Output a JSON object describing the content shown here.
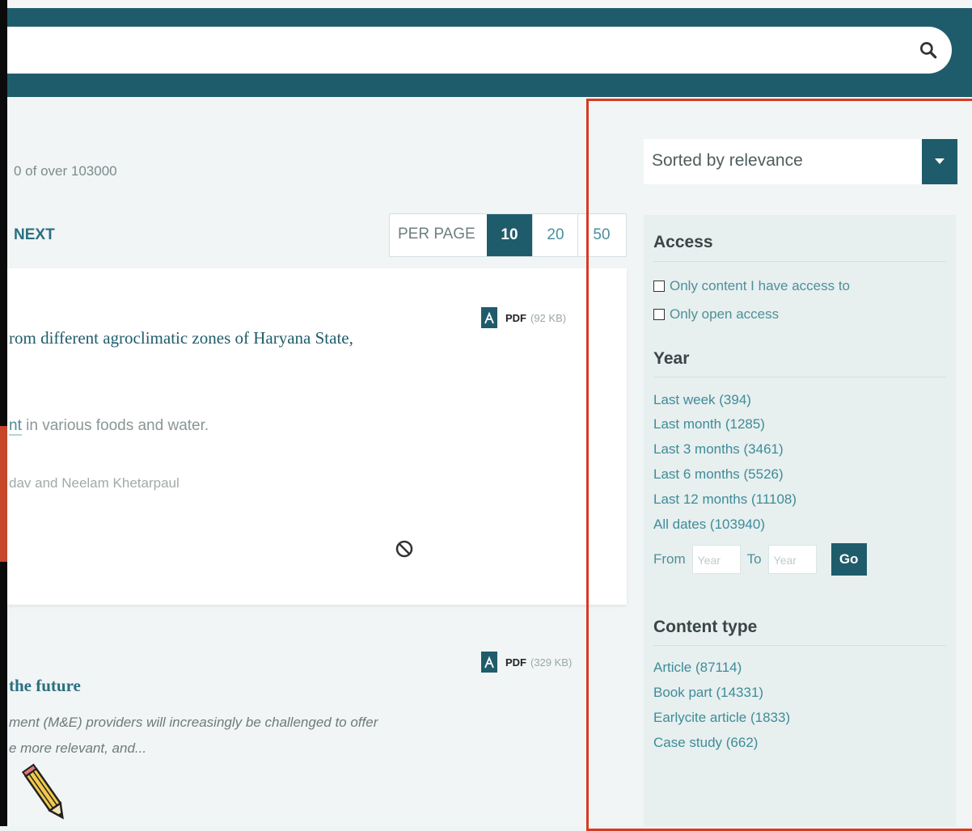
{
  "search": {
    "placeholder": ""
  },
  "results": {
    "count_text": "0 of over 103000",
    "next_label": "NEXT",
    "per_page": {
      "label": "PER PAGE",
      "options": [
        "10",
        "20",
        "50"
      ],
      "selected": "10"
    }
  },
  "cards": [
    {
      "title": "rom different agroclimatic zones of Haryana State,",
      "snippet_highlight": "nt",
      "snippet_rest": " in various foods and water.",
      "authors": "dav and Neelam Khetarpaul",
      "pdf_label": "PDF",
      "pdf_size": "(92 KB)",
      "access_icon": "no-access-icon"
    },
    {
      "title": "the future",
      "snippet_line1": "ment (M&E) providers will increasingly be challenged to offer",
      "snippet_line2": "e more relevant, and...",
      "pdf_label": "PDF",
      "pdf_size": "(329 KB)"
    }
  ],
  "sort": {
    "label": "Sorted by relevance"
  },
  "facets": {
    "access": {
      "heading": "Access",
      "options": [
        "Only content I have access to",
        "Only open access"
      ]
    },
    "year": {
      "heading": "Year",
      "options": [
        "Last week (394)",
        "Last month (1285)",
        "Last 3 months (3461)",
        "Last 6 months (5526)",
        "Last 12 months (11108)",
        "All dates (103940)"
      ],
      "from_label": "From",
      "to_label": "To",
      "from_placeholder": "Year",
      "to_placeholder": "Year",
      "go_label": "Go"
    },
    "content_type": {
      "heading": "Content type",
      "options": [
        "Article (87114)",
        "Book part (14331)",
        "Earlycite article (1833)",
        "Case study (662)"
      ]
    }
  },
  "colors": {
    "header": "#1f5c6b",
    "accent": "#1f5c6b",
    "link": "#3e8c98",
    "highlight_frame": "#d93a22"
  }
}
